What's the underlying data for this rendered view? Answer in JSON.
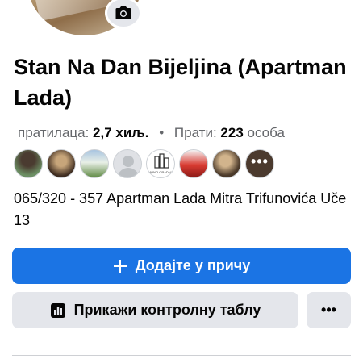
{
  "profile": {
    "name": "Stan Na Dan Bijeljina (Apartman Lada)",
    "camera_icon": "camera-icon"
  },
  "stats": {
    "followers_label": "пратилаца:",
    "followers_value": "2,7 хиљ.",
    "separator": "•",
    "following_label": "Прати:",
    "following_value": "223",
    "following_unit": "особа"
  },
  "followers_preview": {
    "avatars": [
      "avatar-1",
      "avatar-2",
      "avatar-3",
      "avatar-4",
      "avatar-5",
      "avatar-6",
      "avatar-7"
    ],
    "more_label": "•••",
    "logo_caption": "MONO GRADNJA"
  },
  "address": "065/320 - 357 Apartman Lada Mitra Trifunovića Uče 13",
  "actions": {
    "add_story_label": "Додајте у причу",
    "dashboard_label": "Прикажи контролну таблу",
    "more_label": "•••"
  },
  "colors": {
    "primary": "#1b74e4",
    "secondary_bg": "#e4e6eb",
    "text": "#050505",
    "muted": "#65676b"
  }
}
